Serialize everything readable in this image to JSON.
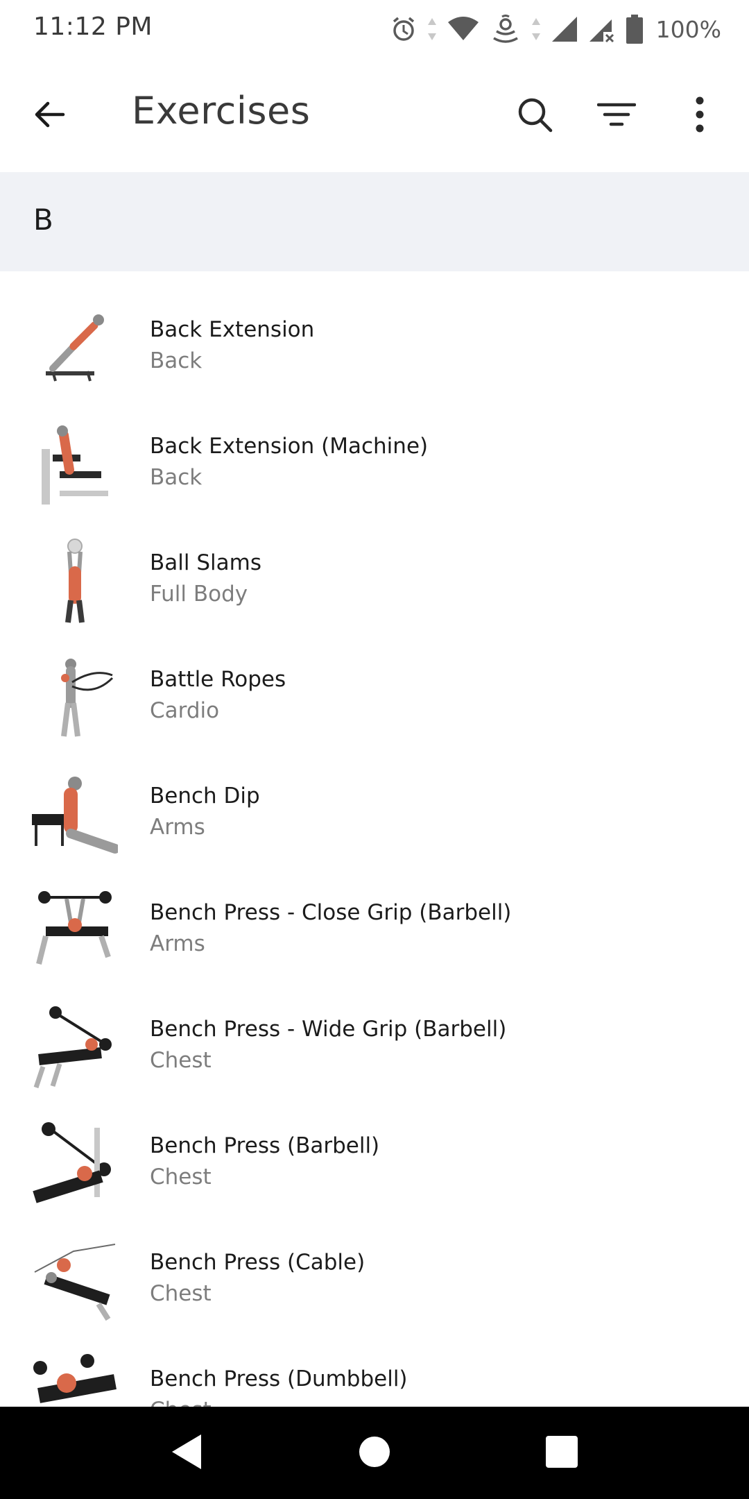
{
  "status_bar": {
    "time": "11:12 PM",
    "battery_percent": "100%",
    "icons": [
      "alarm-icon",
      "wifi-icon",
      "hotspot-icon",
      "signal-icon",
      "signal-no-sim-icon",
      "battery-icon"
    ]
  },
  "app_bar": {
    "title": "Exercises",
    "icons": [
      "back-arrow-icon",
      "search-icon",
      "filter-icon",
      "more-vert-icon"
    ]
  },
  "section": {
    "letter": "B"
  },
  "exercises": [
    {
      "name": "Back Extension",
      "category": "Back"
    },
    {
      "name": "Back Extension (Machine)",
      "category": "Back"
    },
    {
      "name": "Ball Slams",
      "category": "Full Body"
    },
    {
      "name": "Battle Ropes",
      "category": "Cardio"
    },
    {
      "name": "Bench Dip",
      "category": "Arms"
    },
    {
      "name": "Bench Press - Close Grip (Barbell)",
      "category": "Arms"
    },
    {
      "name": "Bench Press - Wide Grip (Barbell)",
      "category": "Chest"
    },
    {
      "name": "Bench Press (Barbell)",
      "category": "Chest"
    },
    {
      "name": "Bench Press (Cable)",
      "category": "Chest"
    },
    {
      "name": "Bench Press (Dumbbell)",
      "category": "Chest"
    }
  ],
  "colors": {
    "section_bg": "#f0f2f6",
    "muscle_highlight": "#d9694a",
    "secondary_text": "#7d7d7d",
    "nav_bar": "#000000"
  }
}
